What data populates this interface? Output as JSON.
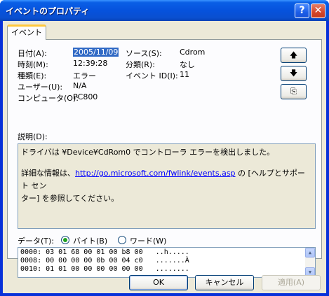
{
  "window": {
    "title": "イベントのプロパティ",
    "help_button": "?",
    "close_button": "✕"
  },
  "tab": {
    "label": "イベント"
  },
  "fields": {
    "date_label": "日付(A):",
    "date_value": "2005/11/09",
    "source_label": "ソース(S):",
    "source_value": "Cdrom",
    "time_label": "時刻(M):",
    "time_value": "12:39:28",
    "category_label": "分類(R):",
    "category_value": "なし",
    "type_label": "種類(E):",
    "type_value": "エラー",
    "event_id_label": "イベント ID(I):",
    "event_id_value": "11",
    "user_label": "ユーザー(U):",
    "user_value": "N/A",
    "computer_label": "コンピュータ(O):",
    "computer_value": "PC800"
  },
  "nav_buttons": {
    "up": "🡅",
    "down": "🡇",
    "copy": "⎘"
  },
  "description": {
    "label": "説明(D):",
    "line1": "ドライバは ¥Device¥CdRom0 でコントローラ エラーを検出しました。",
    "line2_prefix": "詳細な情報は、",
    "link": "http://go.microsoft.com/fwlink/events.asp",
    "line2_suffix": " の [ヘルプとサポート セン",
    "line3": "ター] を参照してください。"
  },
  "data": {
    "label": "データ(T):",
    "radio_bytes": "バイト(B)",
    "radio_words": "ワード(W)",
    "selected": "bytes",
    "lines": [
      "0000: 03 01 68 00 01 00 b8 00   ..h.....",
      "0008: 00 00 00 00 0b 00 04 c0   .......À",
      "0010: 01 01 00 00 00 00 00 00   ........"
    ]
  },
  "buttons": {
    "ok": "OK",
    "cancel": "キャンセル",
    "apply": "適用(A)"
  },
  "colors": {
    "titlebar": "#0652dd",
    "selection": "#316ac5",
    "dialog_bg": "#ece9d8",
    "tab_accent": "#ffc83c",
    "link": "#0000ff"
  }
}
